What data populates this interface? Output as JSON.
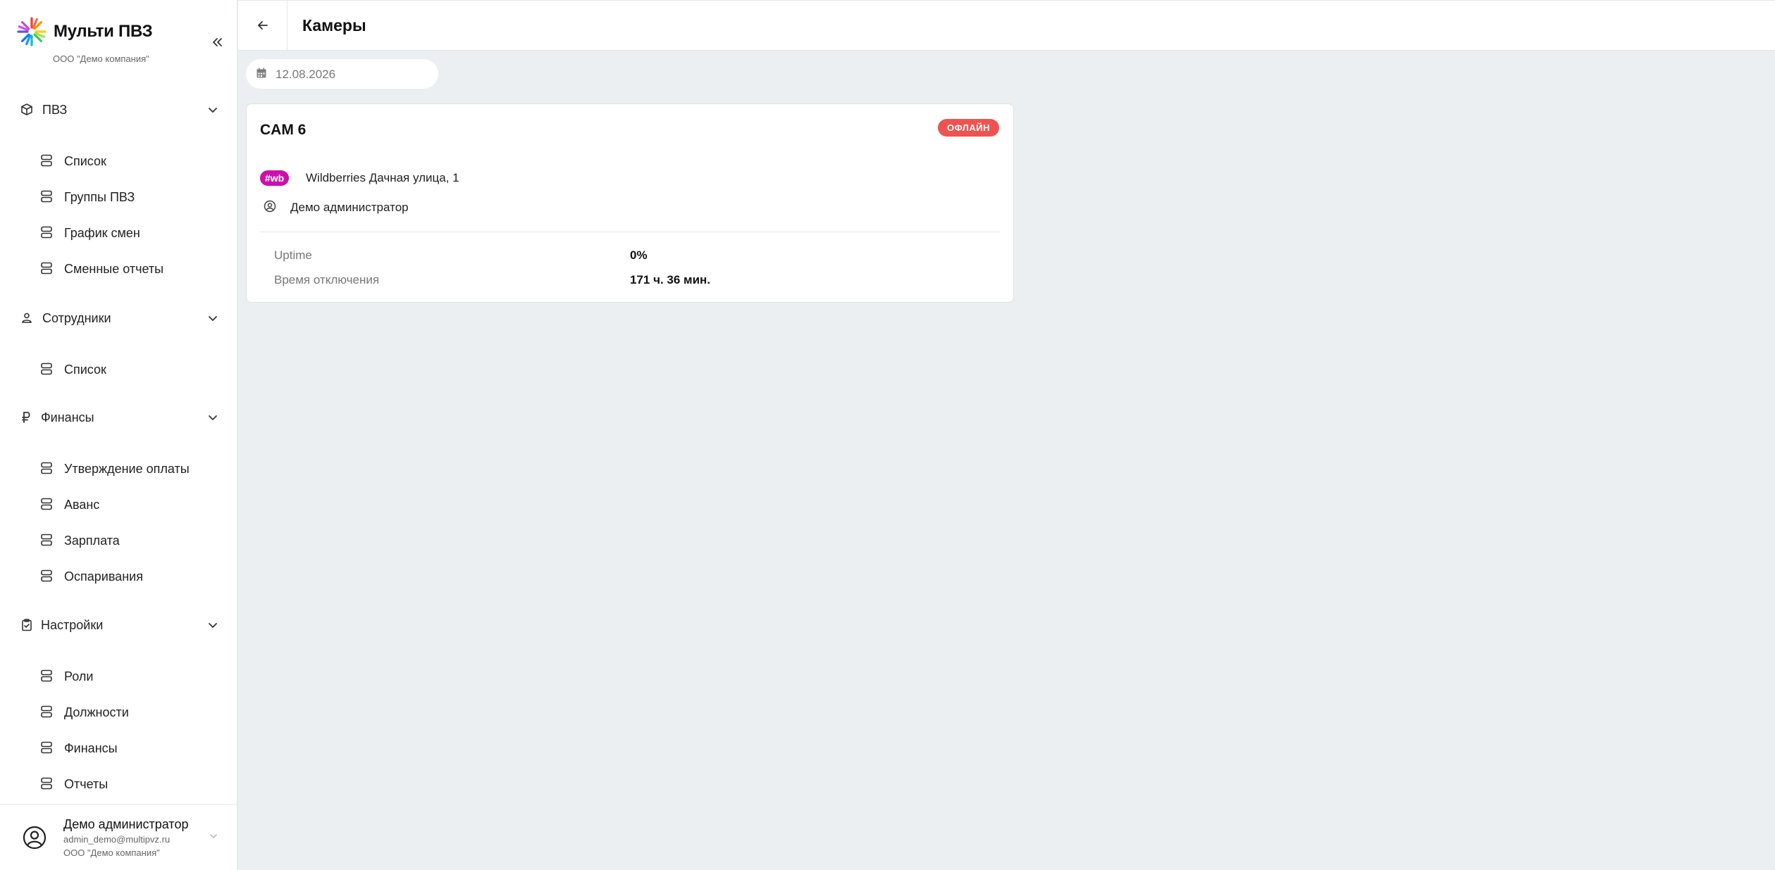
{
  "brand": {
    "name": "Мульти ПВЗ",
    "company": "ООО \"Демо компания\""
  },
  "sidebar": {
    "sections": [
      {
        "label": "ПВЗ",
        "icon": "box-icon",
        "items": [
          "Список",
          "Группы ПВЗ",
          "График смен",
          "Сменные отчеты"
        ]
      },
      {
        "label": "Сотрудники",
        "icon": "person-icon",
        "items": [
          "Список"
        ]
      },
      {
        "label": "Финансы",
        "icon": "ruble-icon",
        "items": [
          "Утверждение оплаты",
          "Аванс",
          "Зарплата",
          "Оспаривания"
        ]
      },
      {
        "label": "Настройки",
        "icon": "clipboard-icon",
        "items": [
          "Роли",
          "Должности",
          "Финансы",
          "Отчеты"
        ]
      }
    ]
  },
  "user": {
    "name": "Демо администратор",
    "email": "admin_demo@multipvz.ru",
    "company": "ООО \"Демо компания\""
  },
  "header": {
    "title": "Камеры"
  },
  "filter": {
    "date": "12.08.2026"
  },
  "camera": {
    "name": "CAM 6",
    "status": "ОФЛАЙН",
    "marketplace_tag": "#wb",
    "pvz": "Wildberries Дачная улица, 1",
    "admin": "Демо администратор",
    "stats": [
      {
        "label": "Uptime",
        "value": "0%"
      },
      {
        "label": "Время отключения",
        "value": "171 ч. 36 мин."
      }
    ]
  },
  "colors": {
    "status_offline": "#ef5350",
    "wb_brand": "#cb11ab",
    "background": "#eceff2"
  }
}
